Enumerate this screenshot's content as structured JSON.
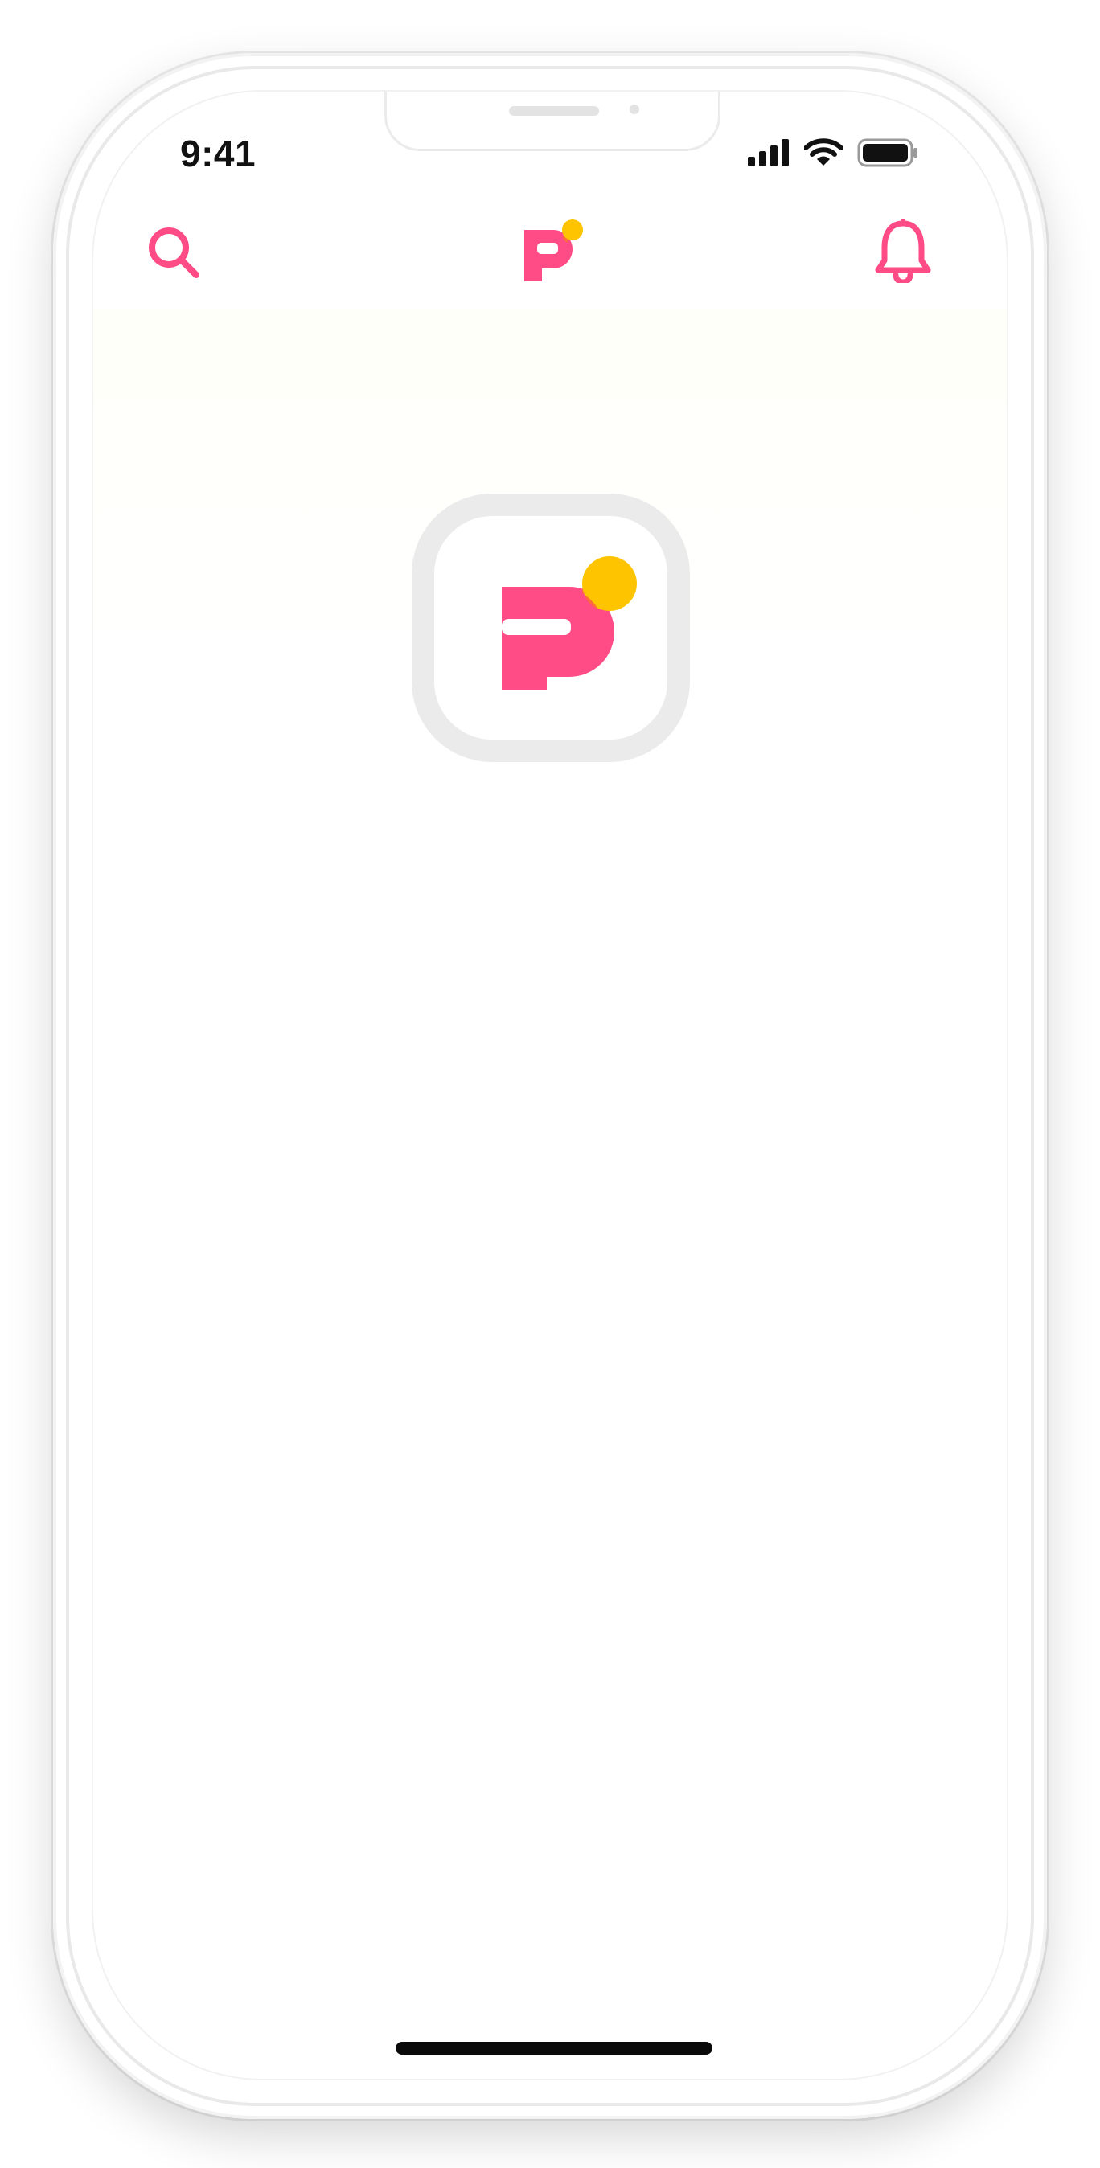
{
  "status_bar": {
    "time": "9:41",
    "icons": [
      "cellular-signal-icon",
      "wifi-icon",
      "battery-icon"
    ]
  },
  "top_nav": {
    "left_icon": "search-icon",
    "center_icon": "app-logo-icon",
    "right_icon": "bell-icon"
  },
  "loading": {
    "icon": "app-logo-icon"
  },
  "colors": {
    "brand_pink": "#ff4b86",
    "brand_yellow": "#ffc400",
    "overlap_orange": "#ff6a3c",
    "ring_gray": "#ebebeb",
    "text_dark": "#111111"
  }
}
